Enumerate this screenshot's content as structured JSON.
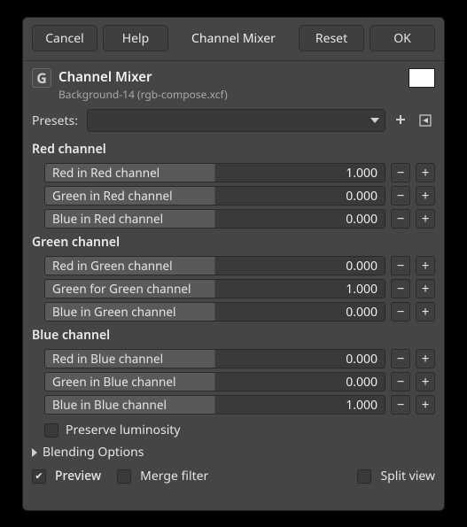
{
  "toolbar": {
    "cancel": "Cancel",
    "help": "Help",
    "title": "Channel Mixer",
    "reset": "Reset",
    "ok": "OK"
  },
  "header": {
    "title": "Channel Mixer",
    "subtitle": "Background-14 (rgb-compose.xcf)",
    "swatch_color": "#ffffff"
  },
  "presets": {
    "label": "Presets:",
    "value": ""
  },
  "sections": {
    "red": {
      "title": "Red channel",
      "rows": [
        {
          "label": "Red in Red channel",
          "value": "1.000",
          "fill_pct": 50
        },
        {
          "label": "Green in Red channel",
          "value": "0.000",
          "fill_pct": 50
        },
        {
          "label": "Blue in Red channel",
          "value": "0.000",
          "fill_pct": 50
        }
      ]
    },
    "green": {
      "title": "Green channel",
      "rows": [
        {
          "label": "Red in Green channel",
          "value": "0.000",
          "fill_pct": 50
        },
        {
          "label": "Green for Green channel",
          "value": "1.000",
          "fill_pct": 50
        },
        {
          "label": "Blue in Green channel",
          "value": "0.000",
          "fill_pct": 50
        }
      ]
    },
    "blue": {
      "title": "Blue channel",
      "rows": [
        {
          "label": "Red in Blue channel",
          "value": "0.000",
          "fill_pct": 50
        },
        {
          "label": "Green in Blue channel",
          "value": "0.000",
          "fill_pct": 50
        },
        {
          "label": "Blue in Blue channel",
          "value": "1.000",
          "fill_pct": 50
        }
      ]
    }
  },
  "options": {
    "preserve_luminosity": {
      "label": "Preserve luminosity",
      "checked": false
    },
    "blending_options": {
      "label": "Blending Options",
      "expanded": false
    },
    "preview": {
      "label": "Preview",
      "checked": true
    },
    "merge_filter": {
      "label": "Merge filter",
      "checked": false
    },
    "split_view": {
      "label": "Split view",
      "checked": false
    }
  }
}
